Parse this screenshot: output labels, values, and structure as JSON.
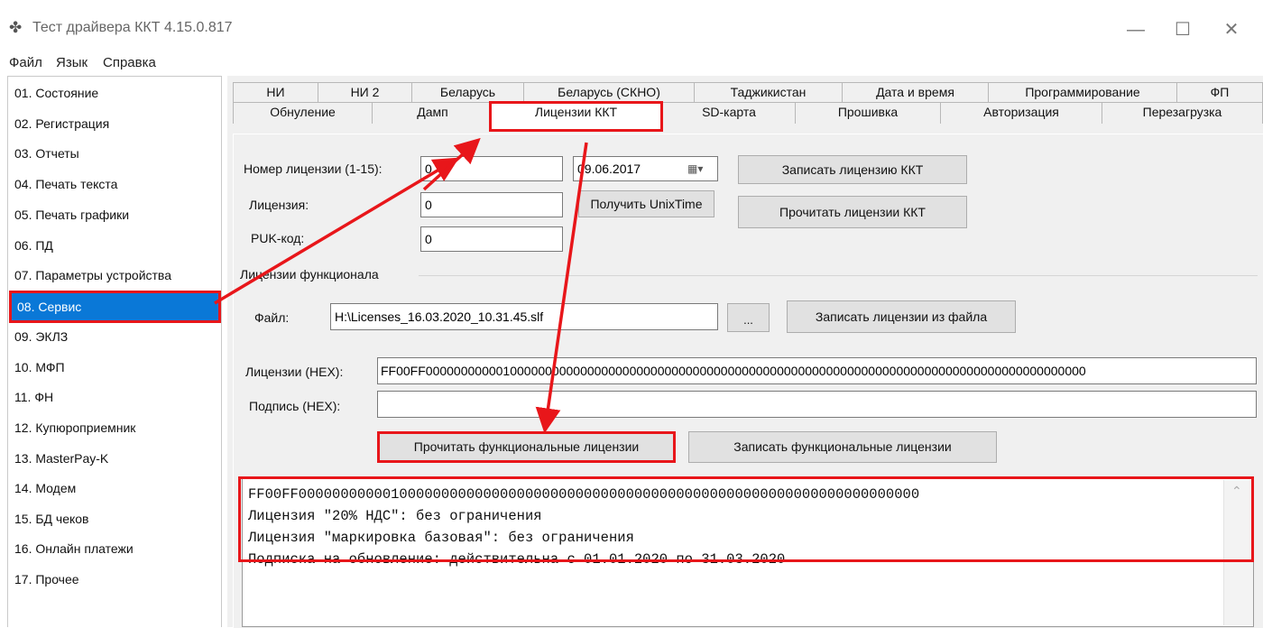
{
  "window": {
    "title": "Тест драйвера ККТ 4.15.0.817",
    "minimize": "—",
    "maximize": "☐",
    "close": "✕"
  },
  "menu": [
    "Файл",
    "Язык",
    "Справка"
  ],
  "sidebar": {
    "items": [
      "01. Состояние",
      "02. Регистрация",
      "03. Отчеты",
      "04. Печать текста",
      "05. Печать графики",
      "06. ПД",
      "07. Параметры устройства",
      "08. Сервис",
      "09. ЭКЛЗ",
      "10. МФП",
      "11. ФН",
      "12. Купюроприемник",
      "13. MasterPay-K",
      "14. Модем",
      "15. БД чеков",
      "16. Онлайн платежи",
      "17. Прочее"
    ],
    "selected_index": 7
  },
  "tabs": {
    "row1": [
      "НИ",
      "НИ 2",
      "Беларусь",
      "Беларусь (СКНО)",
      "Таджикистан",
      "Дата и время",
      "Программирование",
      "ФП"
    ],
    "row2": [
      "Обнуление",
      "Дамп",
      "Лицензии ККТ",
      "SD-карта",
      "Прошивка",
      "Авторизация",
      "Перезагрузка"
    ],
    "active": "Лицензии ККТ"
  },
  "kkt": {
    "license_number_label": "Номер лицензии (1-15):",
    "license_number_value": "0",
    "date_value": "09.06.2017",
    "license_label": "Лицензия:",
    "license_value": "0",
    "puk_label": "PUK-код:",
    "puk_value": "0",
    "get_unixtime": "Получить UnixTime",
    "write_license": "Записать лицензию ККТ",
    "read_licenses": "Прочитать лицензии ККТ"
  },
  "functional": {
    "group_title": "Лицензии функционала",
    "file_label": "Файл:",
    "file_value": "H:\\Licenses_16.03.2020_10.31.45.slf",
    "browse": "...",
    "write_from_file": "Записать лицензии из файла",
    "hex_label": "Лицензии (HEX):",
    "hex_value": "FF00FF0000000000010000000000000000000000000000000000000000000000000000000000000000000000000000000000",
    "sign_label": "Подпись (HEX):",
    "sign_value": "",
    "read_functional": "Прочитать функциональные лицензии",
    "write_functional": "Записать функциональные лицензии"
  },
  "output": {
    "lines": [
      "FF00FF00000000000100000000000000000000000000000000000000000000000000000000000000",
      "Лицензия \"20% НДС\": без ограничения",
      "Лицензия \"маркировка базовая\": без ограничения",
      "Подписка на обновление: действительна с 01.01.2020 по 31.03.2020"
    ]
  },
  "colors": {
    "highlight": "#e8161a",
    "selection": "#0a78d7"
  }
}
